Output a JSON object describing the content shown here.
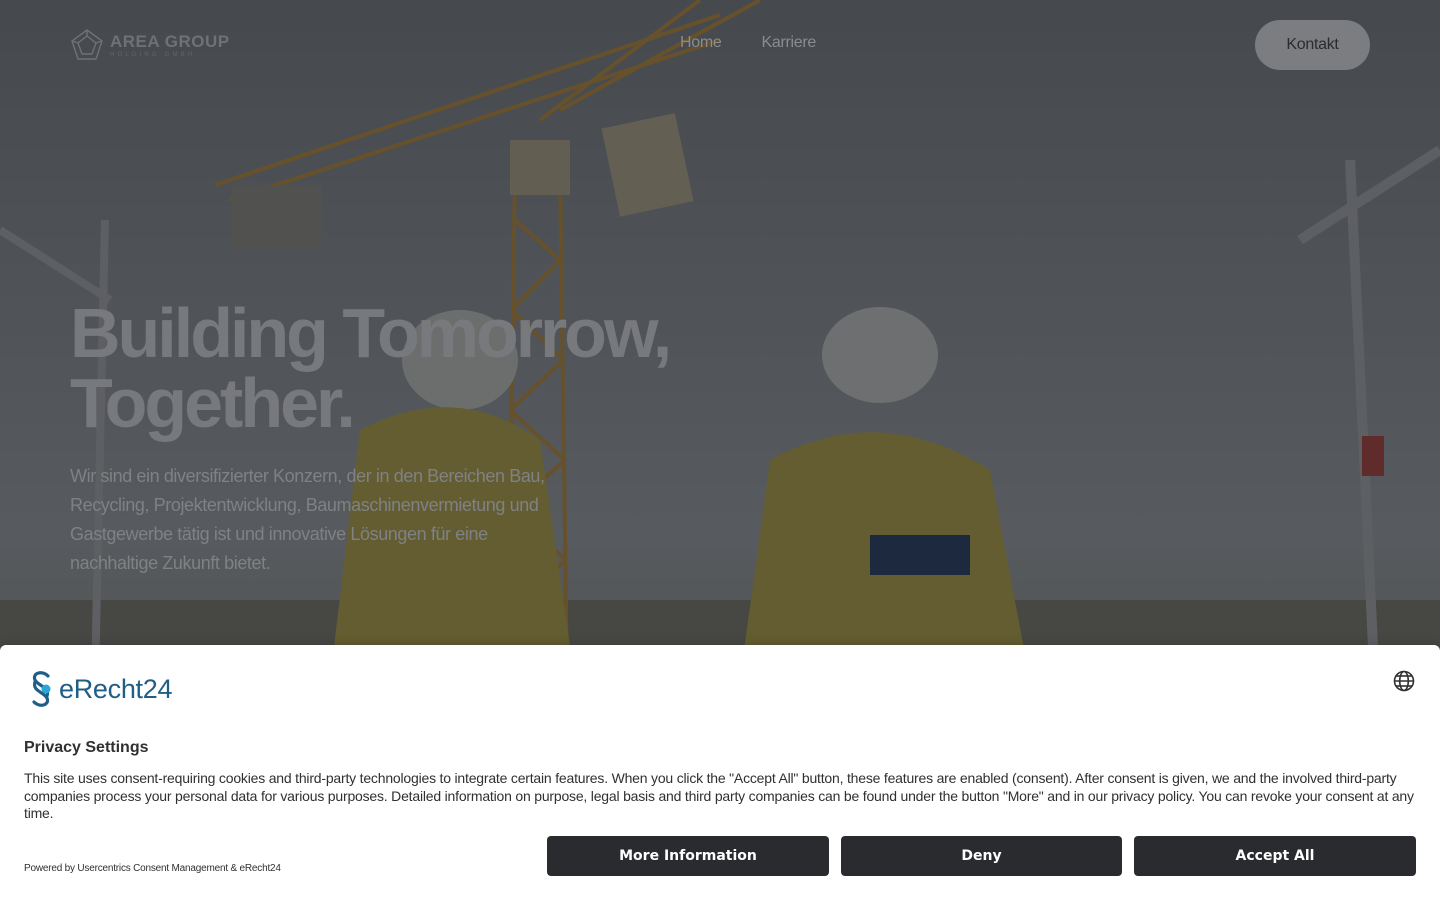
{
  "nav": {
    "logo_name": "AREA GROUP",
    "logo_sub": "HOLDING GMBH",
    "links": [
      "Home",
      "Karriere"
    ],
    "contact_label": "Kontakt"
  },
  "hero": {
    "headline_line1": "Building Tomorrow,",
    "headline_line2": "Together.",
    "intro": "Wir sind  ein diversifizierter Konzern, der in den Bereichen Bau, Recycling, Projektentwicklung, Baumaschinenvermietung und Gastgewerbe tätig ist und innovative Lösungen für eine nachhaltige Zukunft bietet."
  },
  "consent": {
    "brand": "eRecht24",
    "language_icon": "globe-icon",
    "title": "Privacy Settings",
    "text": "This site uses consent-requiring cookies and third-party technologies to integrate certain features. When you click the \"Accept All\" button, these features are enabled (consent). After consent is given, we and the involved third-party companies process your personal data for various purposes. Detailed information on purpose, legal basis and third party companies can be found under the button \"More\" and in our privacy policy. You can revoke your consent at any time.",
    "powered_by": "Powered by Usercentrics Consent Management & eRecht24",
    "buttons": {
      "more": "More Information",
      "deny": "Deny",
      "accept": "Accept All"
    }
  },
  "colors": {
    "overlay": "#1c1e22",
    "button_dark": "#2a2b2e",
    "brand_blue": "#1f5e86",
    "jacket_yellow": "#d8c24a",
    "crane_orange": "#e0a33a"
  }
}
